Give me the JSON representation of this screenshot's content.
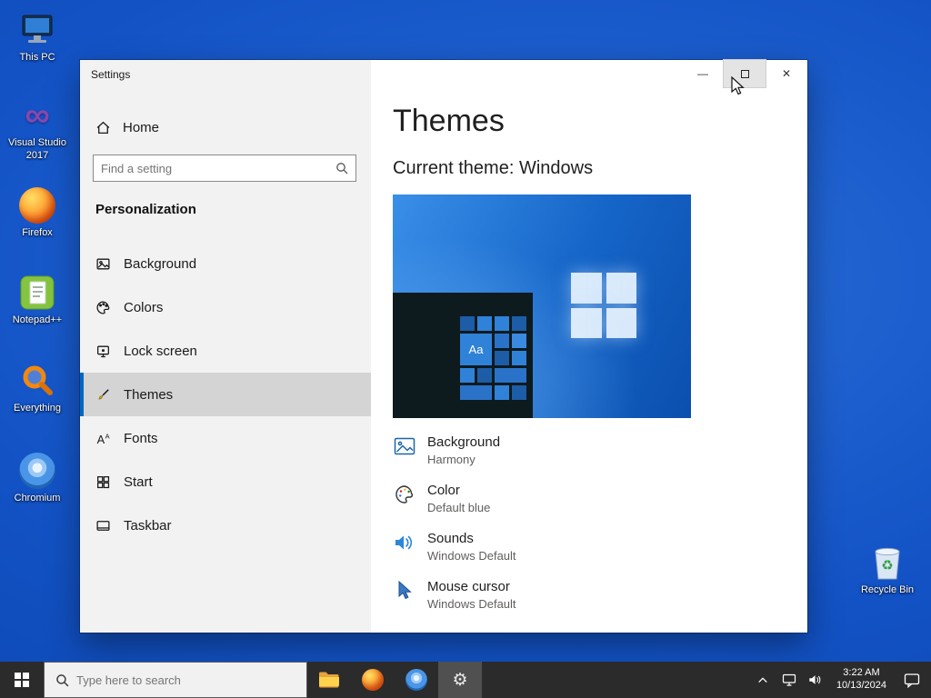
{
  "desktop": {
    "icons": [
      {
        "label": "This PC"
      },
      {
        "label": "Visual Studio 2017"
      },
      {
        "label": "Firefox"
      },
      {
        "label": "Notepad++"
      },
      {
        "label": "Everything"
      },
      {
        "label": "Chromium"
      },
      {
        "label": "Recycle Bin"
      }
    ]
  },
  "window": {
    "title": "Settings",
    "controls": {
      "minimize_glyph": "—",
      "close_glyph": "✕"
    },
    "sidebar": {
      "home_label": "Home",
      "search_placeholder": "Find a setting",
      "section": "Personalization",
      "items": [
        {
          "label": "Background"
        },
        {
          "label": "Colors"
        },
        {
          "label": "Lock screen"
        },
        {
          "label": "Themes",
          "selected": true
        },
        {
          "label": "Fonts"
        },
        {
          "label": "Start"
        },
        {
          "label": "Taskbar"
        }
      ]
    },
    "content": {
      "title": "Themes",
      "current_theme": "Current theme: Windows",
      "preview_tile": "Aa",
      "settings": [
        {
          "title": "Background",
          "value": "Harmony"
        },
        {
          "title": "Color",
          "value": "Default blue"
        },
        {
          "title": "Sounds",
          "value": "Windows Default"
        },
        {
          "title": "Mouse cursor",
          "value": "Windows Default"
        }
      ]
    }
  },
  "taskbar": {
    "search_placeholder": "Type here to search",
    "tray": {
      "time": "3:22 AM",
      "date": "10/13/2024"
    }
  },
  "colors": {
    "accent": "#0067c0",
    "taskbar": "#2b2b2b",
    "desktop_blue": "#1353c6",
    "selected_item": "#d4d4d4"
  }
}
